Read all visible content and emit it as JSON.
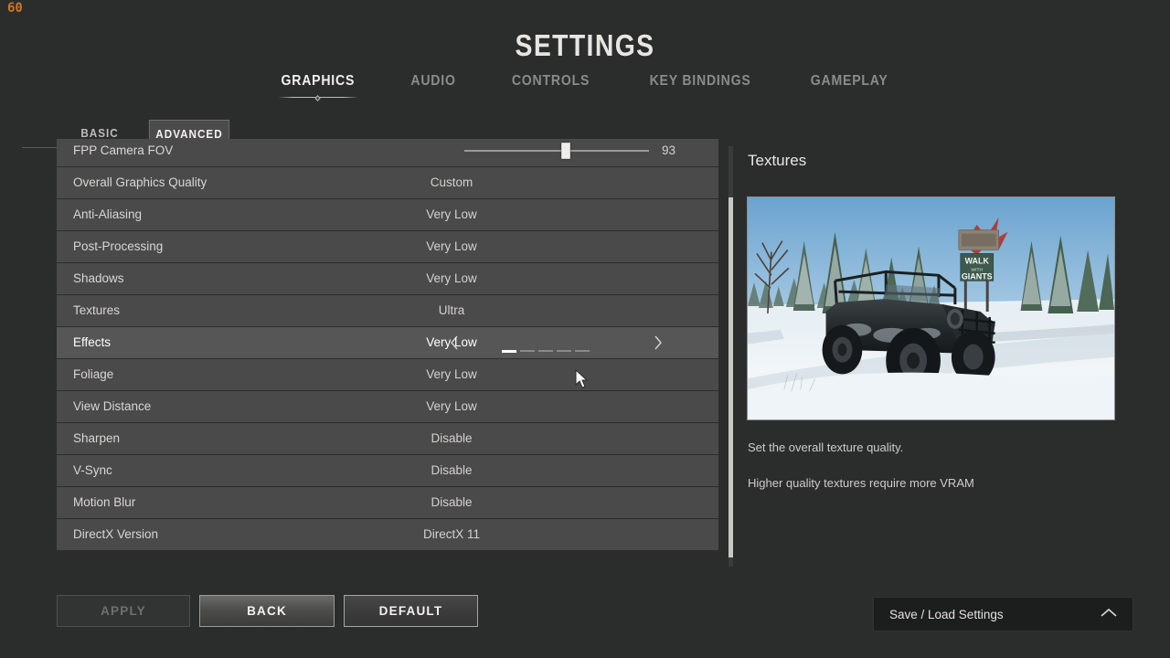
{
  "hud": {
    "fps": "60"
  },
  "header": {
    "title": "SETTINGS",
    "tabs": [
      {
        "label": "GRAPHICS",
        "active": true
      },
      {
        "label": "AUDIO",
        "active": false
      },
      {
        "label": "CONTROLS",
        "active": false
      },
      {
        "label": "KEY BINDINGS",
        "active": false
      },
      {
        "label": "GAMEPLAY",
        "active": false
      }
    ]
  },
  "subtabs": [
    {
      "label": "BASIC",
      "active": false
    },
    {
      "label": "ADVANCED",
      "active": true
    }
  ],
  "settings": {
    "rows": [
      {
        "label": "FPP Camera FOV",
        "value": "93",
        "type": "slider",
        "slider_percent": 55
      },
      {
        "label": "Overall Graphics Quality",
        "value": "Custom",
        "type": "option"
      },
      {
        "label": "Anti-Aliasing",
        "value": "Very Low",
        "type": "option"
      },
      {
        "label": "Post-Processing",
        "value": "Very Low",
        "type": "option"
      },
      {
        "label": "Shadows",
        "value": "Very Low",
        "type": "option"
      },
      {
        "label": "Textures",
        "value": "Ultra",
        "type": "option"
      },
      {
        "label": "Effects",
        "value": "Very Low",
        "type": "option",
        "hovered": true,
        "steps": 5,
        "step_index": 0,
        "prev_icon": "chevron-left-icon",
        "next_icon": "chevron-right-icon"
      },
      {
        "label": "Foliage",
        "value": "Very Low",
        "type": "option"
      },
      {
        "label": "View Distance",
        "value": "Very Low",
        "type": "option"
      },
      {
        "label": "Sharpen",
        "value": "Disable",
        "type": "option"
      },
      {
        "label": "V-Sync",
        "value": "Disable",
        "type": "option"
      },
      {
        "label": "Motion Blur",
        "value": "Disable",
        "type": "option"
      },
      {
        "label": "DirectX Version",
        "value": "DirectX 11",
        "type": "option"
      }
    ]
  },
  "info_panel": {
    "title": "Textures",
    "preview_alt": "snow-scene-offroad-truck-preview",
    "billboard_line1": "WALK",
    "billboard_line2": "WITH",
    "billboard_line3": "GIANTS",
    "description_1": "Set the overall texture quality.",
    "description_2": "Higher quality textures require more VRAM"
  },
  "footer": {
    "apply_label": "APPLY",
    "back_label": "BACK",
    "default_label": "DEFAULT",
    "saveload_label": "Save / Load Settings",
    "saveload_icon": "chevron-up-icon"
  },
  "colors": {
    "background": "#2b2c2c",
    "row": "#4a4a4a",
    "row_hover": "#565656",
    "accent_text": "#f2f0ec",
    "muted_text": "#8b8b8b",
    "fps": "#d4761f",
    "scrollbar": "#c9c7c4"
  }
}
